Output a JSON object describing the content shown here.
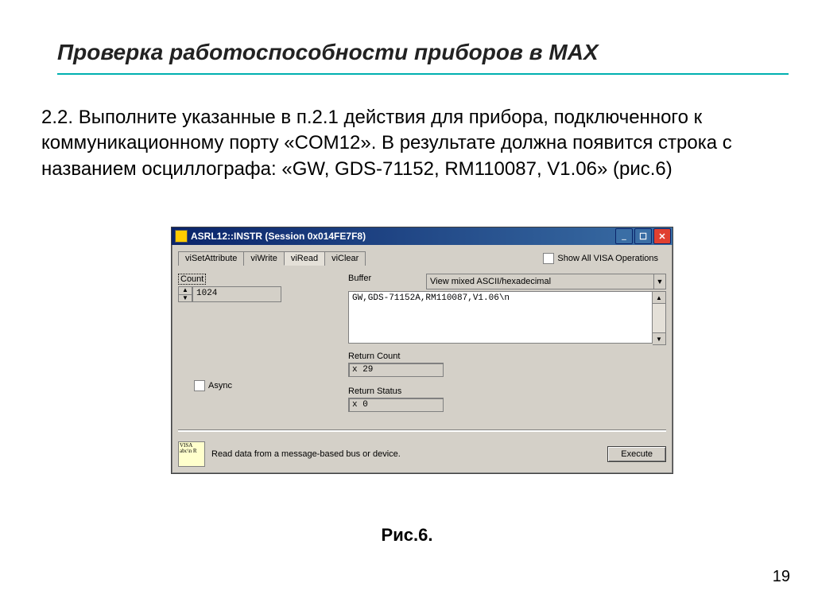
{
  "slide": {
    "title": "Проверка работоспособности  приборов в MAX",
    "body": "2.2. Выполните указанные в п.2.1 действия для прибора, подключенного к коммуникационному порту «COM12». В результате должна появится строка с названием осциллографа: «GW, GDS-71152, RM110087, V1.06» (рис.6)",
    "fig_caption": "Рис.6.",
    "page_number": "19"
  },
  "dialog": {
    "title": "ASRL12::INSTR (Session 0x014FE7F8)",
    "tabs": [
      "viSetAttribute",
      "viWrite",
      "viRead",
      "viClear"
    ],
    "active_tab_index": 2,
    "show_all_label": "Show All VISA Operations",
    "count_label": "Count",
    "count_value": "1024",
    "buffer_label": "Buffer",
    "buffer_mode": "View mixed ASCII/hexadecimal",
    "buffer_text": "GW,GDS-71152A,RM110087,V1.06\\n",
    "async_label": "Async",
    "return_count_label": "Return Count",
    "return_count_value": "x 29",
    "return_status_label": "Return Status",
    "return_status_value": "x 0",
    "footer_icon_text": "VISA\nabc\\n\nR",
    "footer_hint": "Read data from a message-based bus or device.",
    "execute_label": "Execute"
  }
}
